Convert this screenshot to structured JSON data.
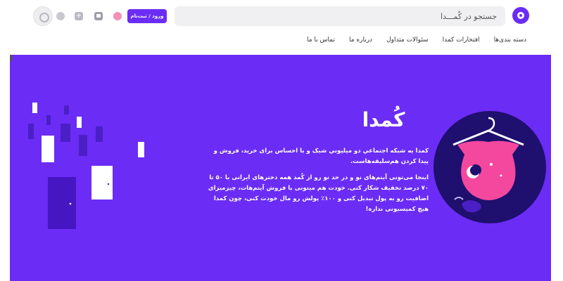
{
  "header": {
    "search_placeholder": "جستجو در کُمـــدا",
    "login_label": "ورود / ثبت‌نام",
    "icons": [
      "logo-icon",
      "sell-icon",
      "store-icon",
      "plus-icon",
      "search-icon",
      "user-avatar-icon"
    ]
  },
  "nav": {
    "items": [
      {
        "label": "دسته بندی‌ها"
      },
      {
        "label": "افتخارات کمدا"
      },
      {
        "label": "سئوالات متداول"
      },
      {
        "label": "درباره ما"
      },
      {
        "label": "تماس با ما"
      }
    ]
  },
  "hero": {
    "brand": "کُمدا",
    "paragraph1": "کمدا یه شبکه اجتماعي دو ميليوني شیک و با احساس برای خرید، فروش و پیدا کردن هم‌سلیقه‌هاست.",
    "paragraph2": "اینجا می‌تونی آیتم‌های نو و در حد نو رو از کُمد همه دخترهای ایرانی با ۵۰ تا ۷۰ درصد تخفیف شکار کنی. خودت هم میتونی با فروش آیتم‌هات، چیزمیزای اضافیت رو به پول تبدیل کنی و ۱۰۰٪ پولش رو مال خودت کنی، چون کمدا هیچ کمیسیونی نداره!",
    "colors": {
      "accent": "#6b2cf5",
      "illustration_bg": "#1f0f6e",
      "dress": "#f4489e"
    }
  }
}
